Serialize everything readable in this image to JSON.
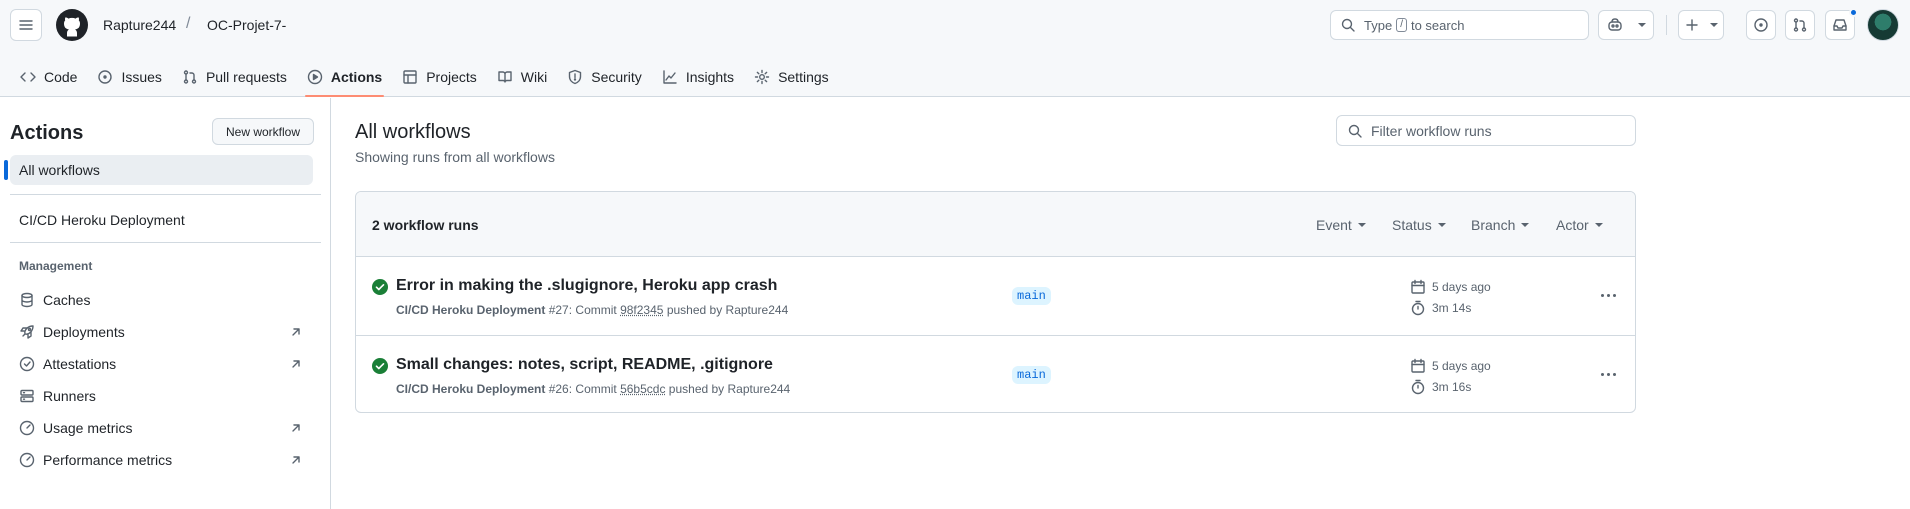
{
  "header": {
    "owner": "Rapture244",
    "separator": "/",
    "repo": "OC-Projet-7-",
    "search": {
      "prefix": "Type",
      "key": "/",
      "suffix": "to search"
    }
  },
  "tabs": [
    {
      "label": "Code",
      "icon": "code-icon"
    },
    {
      "label": "Issues",
      "icon": "issue-opened-icon"
    },
    {
      "label": "Pull requests",
      "icon": "git-pull-request-icon"
    },
    {
      "label": "Actions",
      "icon": "play-icon",
      "active": true
    },
    {
      "label": "Projects",
      "icon": "table-icon"
    },
    {
      "label": "Wiki",
      "icon": "book-icon"
    },
    {
      "label": "Security",
      "icon": "shield-icon"
    },
    {
      "label": "Insights",
      "icon": "graph-icon"
    },
    {
      "label": "Settings",
      "icon": "gear-icon"
    }
  ],
  "sidebar": {
    "title": "Actions",
    "new_workflow": "New workflow",
    "all_workflows": "All workflows",
    "workflow": "CI/CD Heroku Deployment",
    "management_heading": "Management",
    "items": [
      {
        "label": "Caches",
        "icon": "database-icon",
        "external": false
      },
      {
        "label": "Deployments",
        "icon": "rocket-icon",
        "external": true
      },
      {
        "label": "Attestations",
        "icon": "verified-icon",
        "external": true
      },
      {
        "label": "Runners",
        "icon": "server-icon",
        "external": false
      },
      {
        "label": "Usage metrics",
        "icon": "meter-icon",
        "external": true
      },
      {
        "label": "Performance metrics",
        "icon": "meter-icon",
        "external": true
      }
    ]
  },
  "main": {
    "title": "All workflows",
    "subtitle": "Showing runs from all workflows",
    "filter_placeholder": "Filter workflow runs",
    "runs_count": "2 workflow runs",
    "filters": [
      "Event",
      "Status",
      "Branch",
      "Actor"
    ],
    "runs": [
      {
        "title": "Error in making the .slugignore, Heroku app crash",
        "workflow": "CI/CD Heroku Deployment",
        "number": "#27",
        "commit_prefix": ": Commit",
        "sha": "98f2345",
        "pushed_by": "pushed by Rapture244",
        "branch": "main",
        "ago": "5 days ago",
        "duration": "3m 14s",
        "status": "success"
      },
      {
        "title": "Small changes: notes, script, README, .gitignore",
        "workflow": "CI/CD Heroku Deployment",
        "number": "#26",
        "commit_prefix": ": Commit",
        "sha": "56b5cdc",
        "pushed_by": "pushed by Rapture244",
        "branch": "main",
        "ago": "5 days ago",
        "duration": "3m 16s",
        "status": "success"
      }
    ]
  },
  "colors": {
    "accent": "#0969da",
    "success": "#1a7f37",
    "tab_underline": "#fd8c73"
  }
}
